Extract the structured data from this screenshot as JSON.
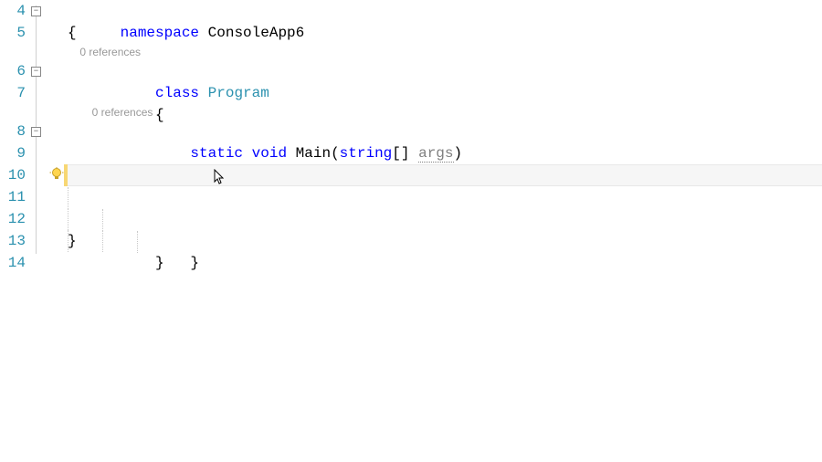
{
  "lineNumbers": [
    "4",
    "5",
    "6",
    "7",
    "8",
    "9",
    "10",
    "11",
    "12",
    "13",
    "14"
  ],
  "codelens": {
    "class": "0 references",
    "method": "0 references"
  },
  "code": {
    "line4": {
      "kw": "namespace",
      "name": " ConsoleApp6"
    },
    "line5": "{",
    "line6": {
      "indent": "    ",
      "kw": "class",
      "name": " Program"
    },
    "line7": {
      "indent": "    ",
      "brace": "{"
    },
    "line8": {
      "indent": "        ",
      "kw1": "static",
      "sp1": " ",
      "kw2": "void",
      "sp2": " ",
      "method": "Main(",
      "paramType": "string",
      "brackets": "[] ",
      "paramName": "args",
      "close": ")"
    },
    "line9": {
      "indent": "        ",
      "brace": "{"
    },
    "line10": "",
    "line11": {
      "indent": "        ",
      "brace": "}"
    },
    "line12": {
      "indent": "    ",
      "brace": "}"
    },
    "line13": "}",
    "line14": ""
  },
  "icons": {
    "foldMinus": "−",
    "lightbulb": "lightbulb-icon"
  }
}
